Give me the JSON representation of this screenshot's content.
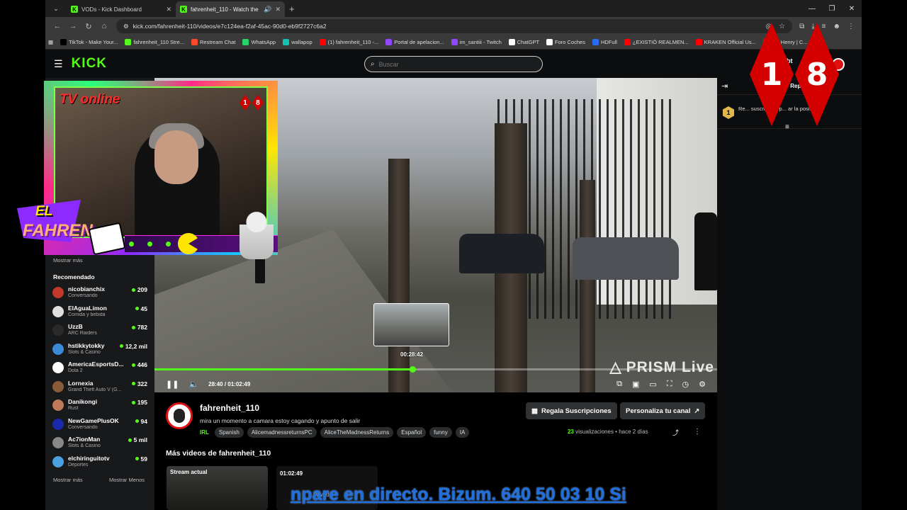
{
  "browser": {
    "tabs": [
      {
        "title": "VODs - Kick Dashboard",
        "active": false
      },
      {
        "title": "fahrenheit_110 - Watch the",
        "active": true
      }
    ],
    "url": "kick.com/fahrenheit-110/videos/e7c124ea-f2af-45ac-90d0-eb9f2727c6a2",
    "bookmarks": [
      {
        "label": "TikTok - Make Your...",
        "color": "#000000"
      },
      {
        "label": "fahrenheit_110 Stre...",
        "color": "#53fc18"
      },
      {
        "label": "Restream Chat",
        "color": "#ff4a2a"
      },
      {
        "label": "WhatsApp",
        "color": "#25d366"
      },
      {
        "label": "wallapop",
        "color": "#13c1ac"
      },
      {
        "label": "(1) fahrenheit_110 -...",
        "color": "#ff0000"
      },
      {
        "label": "Portal de apelacion...",
        "color": "#9146ff"
      },
      {
        "label": "im_santiii - Twitch",
        "color": "#9146ff"
      },
      {
        "label": "ChatGPT",
        "color": "#ffffff"
      },
      {
        "label": "Foro Coches",
        "color": "#ffffff"
      },
      {
        "label": "HDFull",
        "color": "#2a6cf0"
      },
      {
        "label": "¿EXISTIÓ REALMEN...",
        "color": "#ff0000"
      },
      {
        "label": "KRAKEN Official Us...",
        "color": "#ff0000"
      },
      {
        "label": "ore Henry | C...",
        "color": "#ff0000"
      }
    ]
  },
  "kick": {
    "logo": "KICK",
    "search_placeholder": "Buscar",
    "obt_label": "Obt"
  },
  "sidebar": {
    "show_more_top": "Mostrar más",
    "recommended_heading": "Recomendado",
    "recommended": [
      {
        "name": "nicobianchix",
        "category": "Conversando",
        "viewers": "209",
        "color": "#c0392b"
      },
      {
        "name": "ElAguaLimon",
        "category": "Comida y bebida",
        "viewers": "45",
        "color": "#e0e0e0"
      },
      {
        "name": "UzzB",
        "category": "ARC Raiders",
        "viewers": "782",
        "color": "#2a2a2a"
      },
      {
        "name": "hstikkytokky",
        "category": "Slots & Casino",
        "viewers": "12,2 mil",
        "color": "#3a8ad8"
      },
      {
        "name": "AmericaEsportsD...",
        "category": "Dota 2",
        "viewers": "446",
        "color": "#ffffff"
      },
      {
        "name": "Lornexia",
        "category": "Grand Theft Auto V (G...",
        "viewers": "322",
        "color": "#8a5a3a"
      },
      {
        "name": "Danikongi",
        "category": "Rust",
        "viewers": "195",
        "color": "#c07a5a"
      },
      {
        "name": "NewGamePlusOK",
        "category": "Conversando",
        "viewers": "94",
        "color": "#1a2aa8"
      },
      {
        "name": "Ac7ionMan",
        "category": "Slots & Casino",
        "viewers": "5 mil",
        "color": "#888888"
      },
      {
        "name": "elchiringuitotv",
        "category": "Deportes",
        "viewers": "59",
        "color": "#4aa0e0"
      }
    ],
    "show_more_bottom": "Mostrar más",
    "show_less": "Mostrar Menos"
  },
  "overlay": {
    "tv_online": "TV online",
    "mini_badge": [
      "1",
      "8"
    ],
    "el": "EL",
    "fahren": "FAHREN"
  },
  "badge_18": [
    "1",
    "8"
  ],
  "video": {
    "preview_time": "00:28:42",
    "current_time": "28:40",
    "duration": "01:02:49",
    "timecode": "28:40 / 01:02:49",
    "progress": 0.458,
    "watermark": "PRISM Live"
  },
  "chat": {
    "title": "Rep",
    "pinned_rank": "1",
    "pinned_text": "Re... suscripción p... ar la posi..."
  },
  "meta": {
    "channel": "fahrenheit_110",
    "title": "mira un momento a camara estoy cagando y apunto de salir",
    "category": "IRL",
    "tags": [
      "Spanish",
      "AlicemadnessreturnsPC",
      "AliceTheMadnessReturns",
      "Español",
      "funny",
      "IA"
    ],
    "gift_subs": "Regala Suscripciones",
    "customize": "Personaliza tu canal",
    "views_count": "23",
    "views_label": "visualizaciones",
    "age": "hace 2 días",
    "more_videos": "Más videos de fahrenheit_110",
    "thumb1_label": "Stream actual",
    "thumb2_duration": "01:02:49",
    "thumb2_private": "Privado"
  },
  "ticker": "npare en directo. Bizum. 640 50 03 10 Si"
}
